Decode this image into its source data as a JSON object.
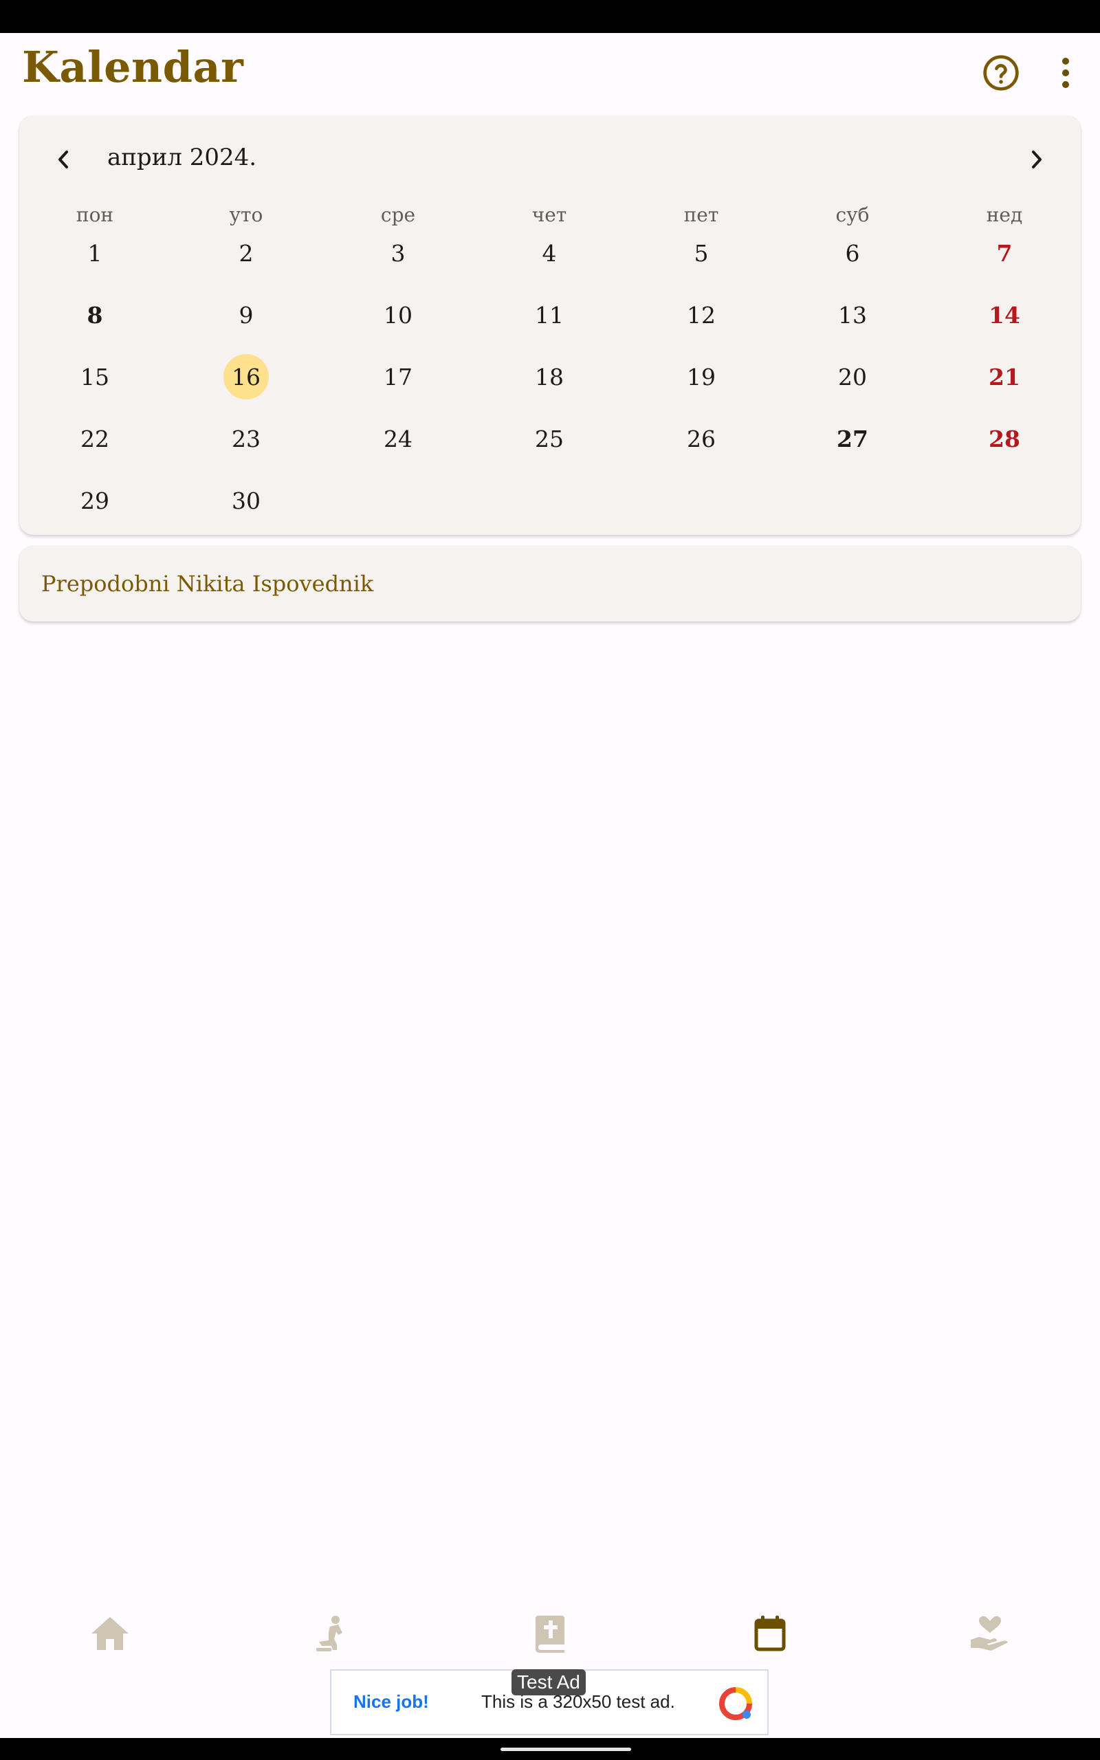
{
  "app": {
    "title": "Kalendar"
  },
  "toolbar": {
    "help_icon": "help-circle-icon",
    "more_icon": "more-vertical-icon"
  },
  "calendar": {
    "month_label": "април 2024.",
    "weekdays": [
      "пон",
      "уто",
      "сре",
      "чет",
      "пет",
      "суб",
      "нед"
    ],
    "days": [
      "1",
      "2",
      "3",
      "4",
      "5",
      "6",
      "7",
      "8",
      "9",
      "10",
      "11",
      "12",
      "13",
      "14",
      "15",
      "16",
      "17",
      "18",
      "19",
      "20",
      "21",
      "22",
      "23",
      "24",
      "25",
      "26",
      "27",
      "28",
      "29",
      "30"
    ],
    "selected_day": "16",
    "bold_days": [
      "8",
      "27"
    ],
    "sunday_days": [
      "7",
      "14",
      "21",
      "28"
    ],
    "colors": {
      "accent": "#7a5a00",
      "sunday": "#b3191f",
      "selected_bg": "#ffe08c",
      "card_bg": "#f6f2ef"
    }
  },
  "feast": {
    "text": "Prepodobni Nikita Ispovednik"
  },
  "bottom_nav": {
    "items": [
      {
        "icon": "home-icon",
        "active": false
      },
      {
        "icon": "praying-person-icon",
        "active": false
      },
      {
        "icon": "prayer-book-icon",
        "active": false
      },
      {
        "icon": "calendar-icon",
        "active": true
      },
      {
        "icon": "charity-hand-heart-icon",
        "active": false
      }
    ],
    "colors": {
      "active": "#6b4f00",
      "inactive": "#cfc5b3"
    }
  },
  "ad": {
    "label": "Test Ad",
    "nice": "Nice job!",
    "text": "This is a 320x50 test ad."
  }
}
